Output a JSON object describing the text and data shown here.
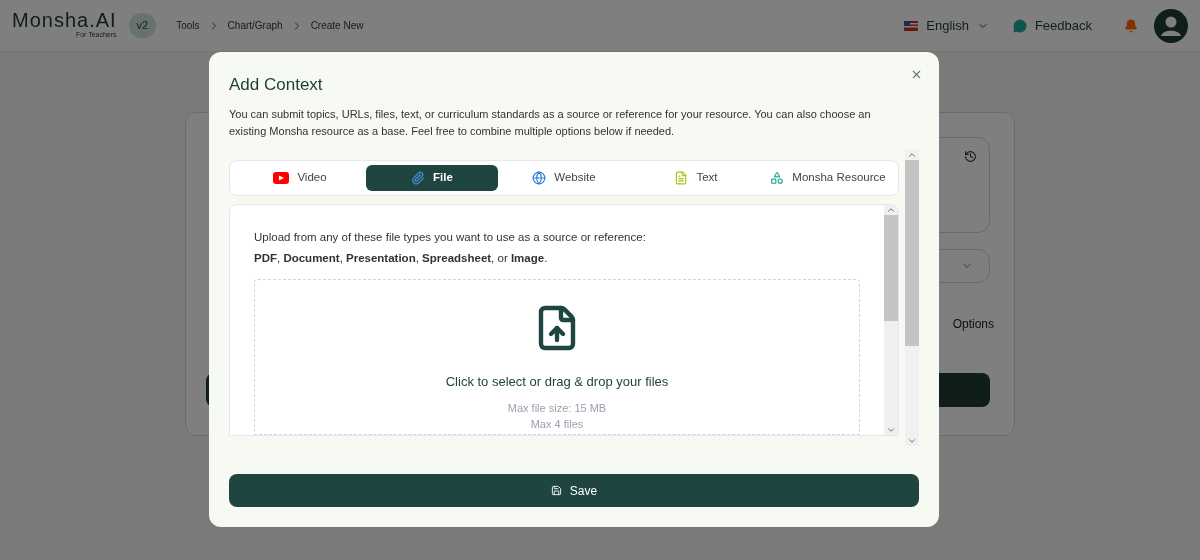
{
  "header": {
    "logo": "Monsha.AI",
    "logo_sub": "For Teachers",
    "version": "v2",
    "breadcrumbs": [
      "Tools",
      "Chart/Graph",
      "Create New"
    ],
    "language": "English",
    "feedback": "Feedback"
  },
  "background": {
    "options_label": "Options"
  },
  "modal": {
    "title": "Add Context",
    "description": "You can submit topics, URLs, files, text, or curriculum standards as a source or reference for your resource. You can also choose an existing Monsha resource as a base. Feel free to combine multiple options below if needed.",
    "tabs": [
      {
        "label": "Video",
        "kind": "video",
        "selected": false
      },
      {
        "label": "File",
        "kind": "file",
        "selected": true
      },
      {
        "label": "Website",
        "kind": "website",
        "selected": false
      },
      {
        "label": "Text",
        "kind": "text",
        "selected": false
      },
      {
        "label": "Monsha Resource",
        "kind": "resource",
        "selected": false
      }
    ],
    "file_panel": {
      "intro": "Upload from any of these file types you want to use as a source or reference:",
      "file_types": "**PDF**, **Document**, **Presentation**, **Spreadsheet**, or **Image**.",
      "drop_text": "Click to select or drag & drop your files",
      "limits": [
        "Max file size: 15 MB",
        "Max 4 files"
      ]
    },
    "save": "Save"
  }
}
